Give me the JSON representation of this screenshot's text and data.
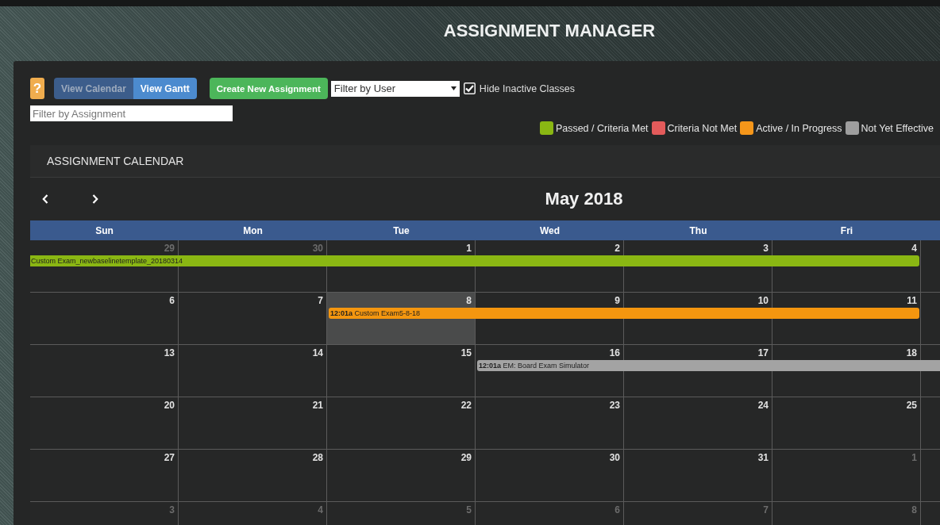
{
  "page": {
    "title": "ASSIGNMENT MANAGER"
  },
  "toolbar": {
    "help_button": "?",
    "view_tabs": [
      {
        "label": "View Calendar",
        "selected": true
      },
      {
        "label": "View Gantt",
        "selected": false
      }
    ],
    "create_button": "Create New Assignment",
    "user_filter": {
      "value": "Filter by User"
    },
    "hide_inactive": {
      "label": "Hide Inactive Classes",
      "checked": true
    },
    "assignment_filter": {
      "placeholder": "Filter by Assignment"
    }
  },
  "legend": [
    {
      "label": "Passed / Criteria Met",
      "color": "#8ab713"
    },
    {
      "label": "Criteria Not Met",
      "color": "#e35b5b"
    },
    {
      "label": "Active / In Progress",
      "color": "#f5961a"
    },
    {
      "label": "Not Yet Effective",
      "color": "#9e9e9e"
    }
  ],
  "calendar": {
    "title": "ASSIGNMENT CALENDAR",
    "month": "May 2018",
    "weekdays": [
      "Sun",
      "Mon",
      "Tue",
      "Wed",
      "Thu",
      "Fri"
    ],
    "weeks": [
      {
        "days": [
          {
            "date": "29",
            "other_month": true,
            "today": false,
            "has_event": true
          },
          {
            "date": "30",
            "other_month": true,
            "today": false,
            "has_event": true
          },
          {
            "date": "1",
            "other_month": false,
            "today": false,
            "has_event": true
          },
          {
            "date": "2",
            "other_month": false,
            "today": false,
            "has_event": true
          },
          {
            "date": "3",
            "other_month": false,
            "today": false,
            "has_event": true
          },
          {
            "date": "4",
            "other_month": false,
            "today": false,
            "has_event": true
          }
        ],
        "event": {
          "title": "Custom Exam_newbaselinetemplate_20180314",
          "color": "#8ab713",
          "continues_before": true,
          "continues_after": false
        }
      },
      {
        "days": [
          {
            "date": "6",
            "other_month": false,
            "today": false,
            "has_event": false
          },
          {
            "date": "7",
            "other_month": false,
            "today": false,
            "has_event": false
          },
          {
            "date": "8",
            "other_month": false,
            "today": true,
            "has_event": true
          },
          {
            "date": "9",
            "other_month": false,
            "today": false,
            "has_event": true
          },
          {
            "date": "10",
            "other_month": false,
            "today": false,
            "has_event": true
          },
          {
            "date": "11",
            "other_month": false,
            "today": false,
            "has_event": true
          }
        ],
        "event": {
          "time": "12:01a",
          "title": "Custom Exam5-8-18",
          "color": "#f4960f",
          "continues_before": false,
          "continues_after": false
        }
      },
      {
        "days": [
          {
            "date": "13",
            "other_month": false,
            "today": false,
            "has_event": false
          },
          {
            "date": "14",
            "other_month": false,
            "today": false,
            "has_event": false
          },
          {
            "date": "15",
            "other_month": false,
            "today": false,
            "has_event": false
          },
          {
            "date": "16",
            "other_month": false,
            "today": false,
            "has_event": true
          },
          {
            "date": "17",
            "other_month": false,
            "today": false,
            "has_event": true
          },
          {
            "date": "18",
            "other_month": false,
            "today": false,
            "has_event": true
          }
        ],
        "event": {
          "time": "12:01a",
          "title": "EM: Board Exam Simulator",
          "color": "#a3a3a3",
          "continues_before": false,
          "continues_after": true
        }
      },
      {
        "days": [
          {
            "date": "20",
            "other_month": false,
            "today": false
          },
          {
            "date": "21",
            "other_month": false,
            "today": false
          },
          {
            "date": "22",
            "other_month": false,
            "today": false
          },
          {
            "date": "23",
            "other_month": false,
            "today": false
          },
          {
            "date": "24",
            "other_month": false,
            "today": false
          },
          {
            "date": "25",
            "other_month": false,
            "today": false
          }
        ]
      },
      {
        "days": [
          {
            "date": "27",
            "other_month": false,
            "today": false
          },
          {
            "date": "28",
            "other_month": false,
            "today": false
          },
          {
            "date": "29",
            "other_month": false,
            "today": false
          },
          {
            "date": "30",
            "other_month": false,
            "today": false
          },
          {
            "date": "31",
            "other_month": false,
            "today": false
          },
          {
            "date": "1",
            "other_month": true,
            "today": false
          }
        ]
      },
      {
        "days": [
          {
            "date": "3",
            "other_month": true,
            "today": false
          },
          {
            "date": "4",
            "other_month": true,
            "today": false
          },
          {
            "date": "5",
            "other_month": true,
            "today": false
          },
          {
            "date": "6",
            "other_month": true,
            "today": false
          },
          {
            "date": "7",
            "other_month": true,
            "today": false
          },
          {
            "date": "8",
            "other_month": true,
            "today": false
          }
        ]
      }
    ]
  }
}
